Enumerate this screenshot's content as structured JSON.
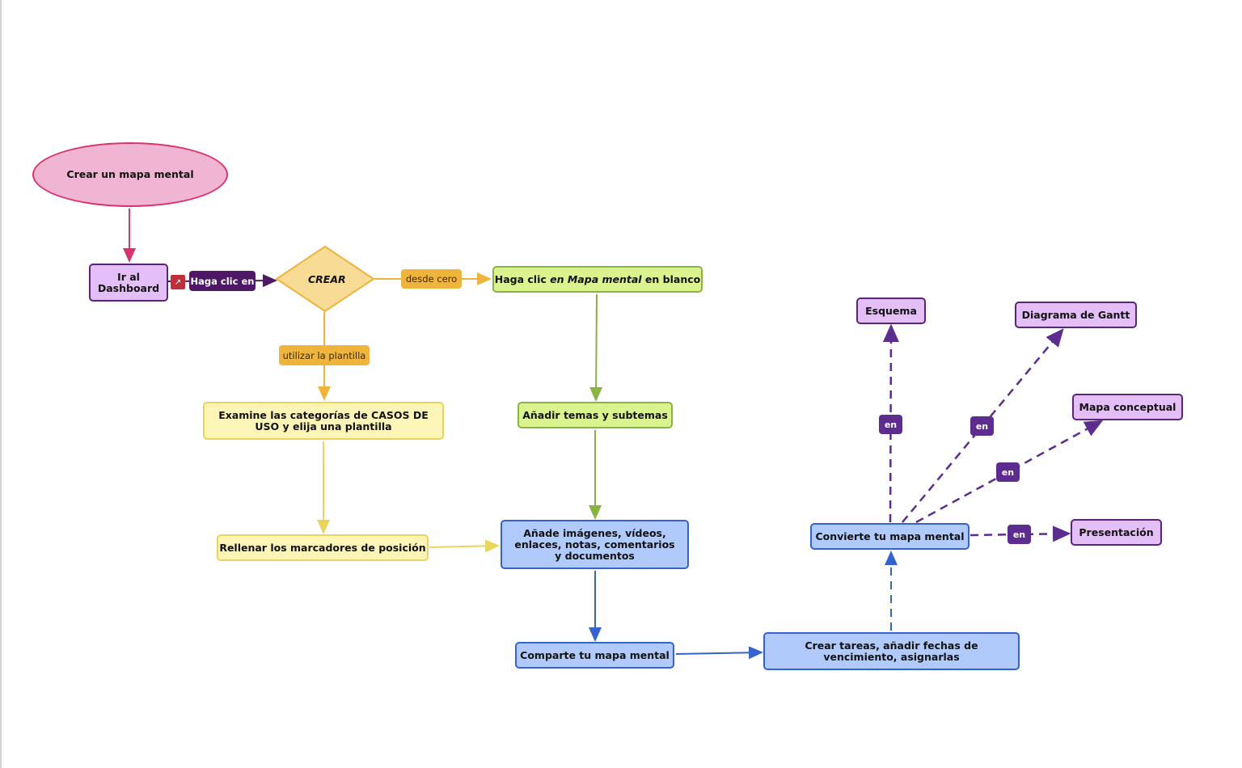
{
  "colors": {
    "pink": "#d9336f",
    "purple_dark": "#4f1866",
    "purple_edge": "#5c2d8f",
    "orange": "#eeb43c",
    "yellow_edge": "#ead45a",
    "green_edge": "#8ab440",
    "blue_edge": "#3462cf"
  },
  "nodes": {
    "start": "Crear un mapa mental",
    "dashboard": "Ir al Dashboard",
    "crear": "CREAR",
    "blank": {
      "pre": "Haga clic ",
      "italic": "en Mapa mental",
      "post": " en blanco"
    },
    "examine": "Examine las categorías de CASOS DE USO y elija una plantilla",
    "topics": "Añadir temas y subtemas",
    "placeholders": "Rellenar los marcadores de posición",
    "media": "Añade imágenes, vídeos, enlaces, notas, comentarios y documentos",
    "share": "Comparte tu mapa mental",
    "tasks": "Crear tareas, añadir fechas de vencimiento, asignarlas",
    "convert": "Convierte tu mapa mental",
    "esquema": "Esquema",
    "gantt": "Diagrama de Gantt",
    "conceptual": "Mapa conceptual",
    "presentacion": "Presentación"
  },
  "edge_labels": {
    "click": "Haga clic en",
    "from_scratch": "desde cero",
    "use_template": "utilizar la plantilla",
    "en": "en"
  }
}
